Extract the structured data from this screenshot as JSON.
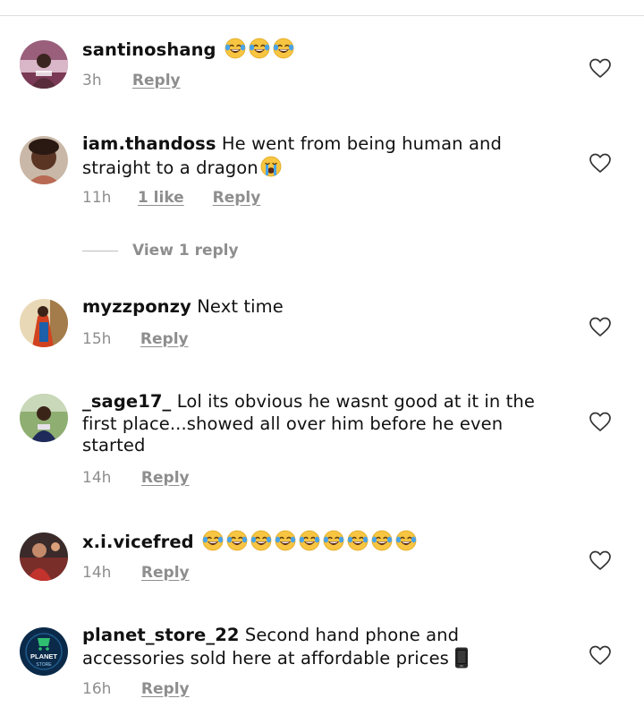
{
  "ui": {
    "reply_label": "Reply"
  },
  "comments": [
    {
      "username": "santinoshang",
      "text": "",
      "emoji": "joy-emoji",
      "emoji_count": 3,
      "time": "3h",
      "likes": ""
    },
    {
      "username": "iam.thandoss",
      "text": "He went from being human and straight to a dragon",
      "emoji": "crying-emoji",
      "emoji_count": 1,
      "time": "11h",
      "likes": "1 like",
      "view_replies": "View 1 reply"
    },
    {
      "username": "myzzponzy",
      "text": "Next time",
      "time": "15h",
      "likes": ""
    },
    {
      "username": "_sage17_",
      "text": "Lol its obvious he wasnt good at it in the first place...showed all over him before he even started",
      "time": "14h",
      "likes": ""
    },
    {
      "username": "x.i.vicefred",
      "text": "",
      "emoji": "joy-emoji",
      "emoji_count": 9,
      "time": "14h",
      "likes": ""
    },
    {
      "username": "planet_store_22",
      "text": "Second hand phone and accessories sold here at affordable prices",
      "emoji": "mobile-phone-emoji",
      "emoji_count": 1,
      "time": "16h",
      "likes": "",
      "avatar_text": [
        "PLANET",
        "STORE"
      ]
    }
  ],
  "colors": {
    "meta_gray": "#8e8e8e",
    "text": "#111111",
    "emoji_yellow": "#f7c541",
    "tear_blue": "#4aa3e8",
    "planet_store_bg": "#0b2a4a",
    "planet_store_accent": "#2fbf71"
  },
  "icons": {
    "like": "heart-outline-icon"
  }
}
